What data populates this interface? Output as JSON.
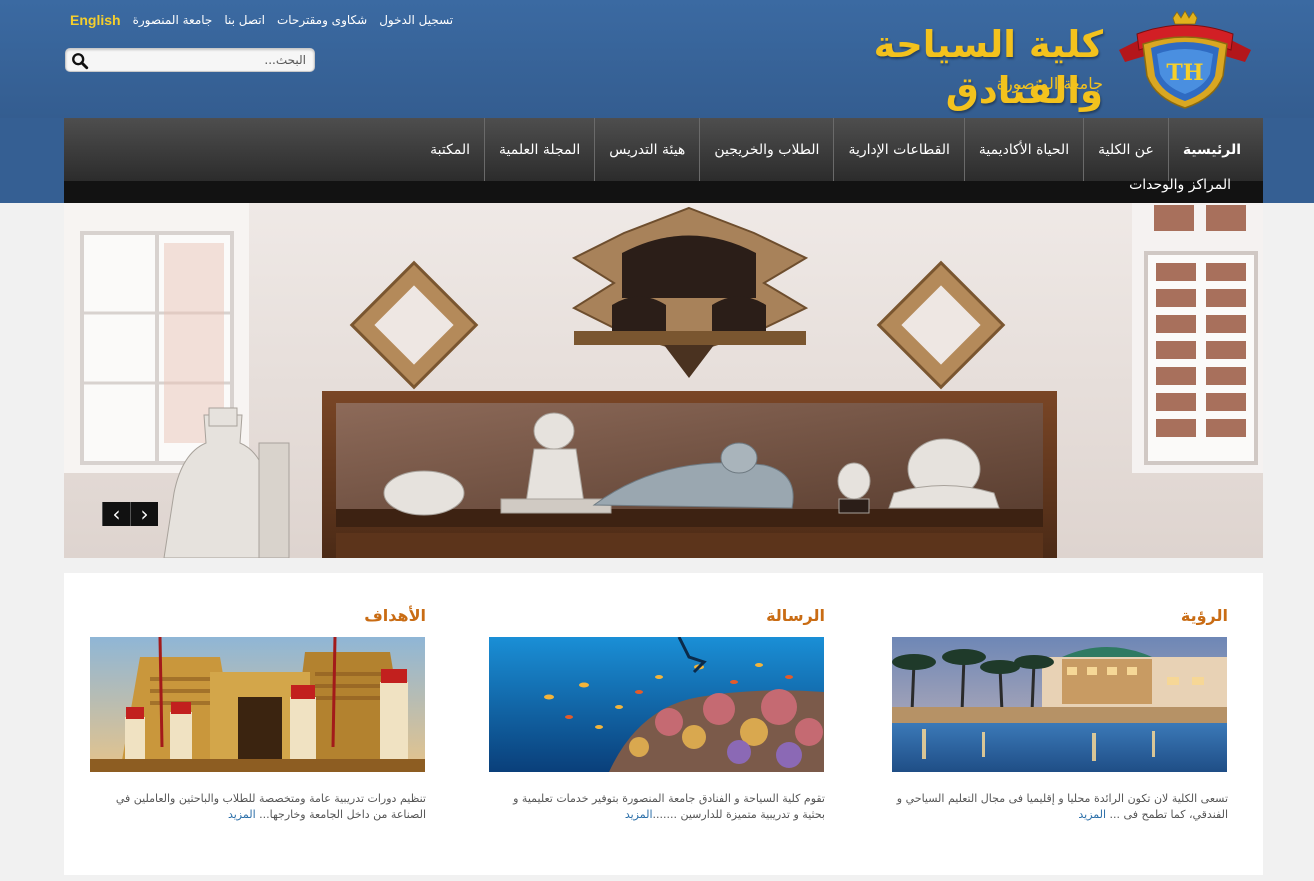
{
  "header": {
    "top_links": {
      "register": "تسجيل الدخول",
      "complaints": "شكاوى ومقترحات",
      "contact": "اتصل بنا",
      "university": "جامعة المنصورة",
      "english": "English"
    },
    "search": {
      "placeholder": "البحث..."
    },
    "logo": {
      "title": "كلية السياحة والفنادق",
      "subtitle": "جامعة المنصورة"
    }
  },
  "nav": {
    "items": [
      "الرئيسية",
      "عن الكلية",
      "الحياة الأكاديمية",
      "القطاعات الإدارية",
      "الطلاب والخريجين",
      "هيئة التدريس",
      "المجلة العلمية",
      "المكتبة"
    ],
    "second_row": "المراكز والوحدات"
  },
  "slider": {
    "prev_icon": "chevron-left-icon",
    "next_icon": "chevron-right-icon",
    "prev_symbol": "‹",
    "next_symbol": "›"
  },
  "sections": {
    "vision": {
      "title": "الرؤية",
      "text": "تسعى الكلية لان تكون الرائدة محليا و إقليميا فى مجال التعليم السياحي و الفندقي، كما تطمح فى ... ",
      "more": "المزيد"
    },
    "mission": {
      "title": "الرسالة",
      "text": "تقوم كلية السياحة و الفنادق جامعة المنصورة بتوفير خدمات تعليمية و بحثية و تدريبية متميزة للدارسين .......",
      "more": "المزيد"
    },
    "goals": {
      "title": "الأهداف",
      "text": "تنظيم دورات تدريبية عامة ومتخصصة للطلاب والباحثين والعاملين في الصناعة من داخل الجامعة وخارجها... ",
      "more": "المزيد"
    }
  },
  "colors": {
    "header_bg": "#355f93",
    "logo_gold": "#f3c21d",
    "section_title": "#c96c14",
    "link": "#2a6ea8"
  }
}
